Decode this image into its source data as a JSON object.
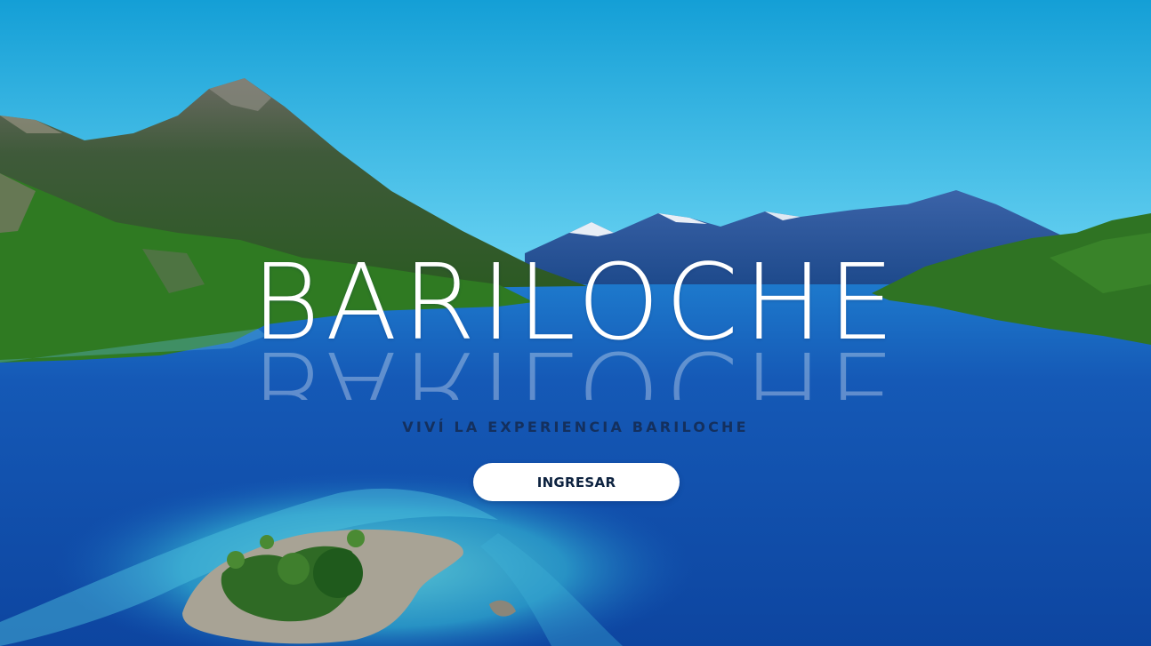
{
  "hero": {
    "title": "BARILOCHE",
    "subtitle": "VIVÍ LA EXPERIENCIA BARILOCHE",
    "cta_label": "INGRESAR"
  },
  "colors": {
    "sky": "#2bb9e4",
    "lake": "#1453b0",
    "subtitle_text": "#14305e",
    "button_bg": "#ffffff",
    "button_text": "#0e2340"
  }
}
